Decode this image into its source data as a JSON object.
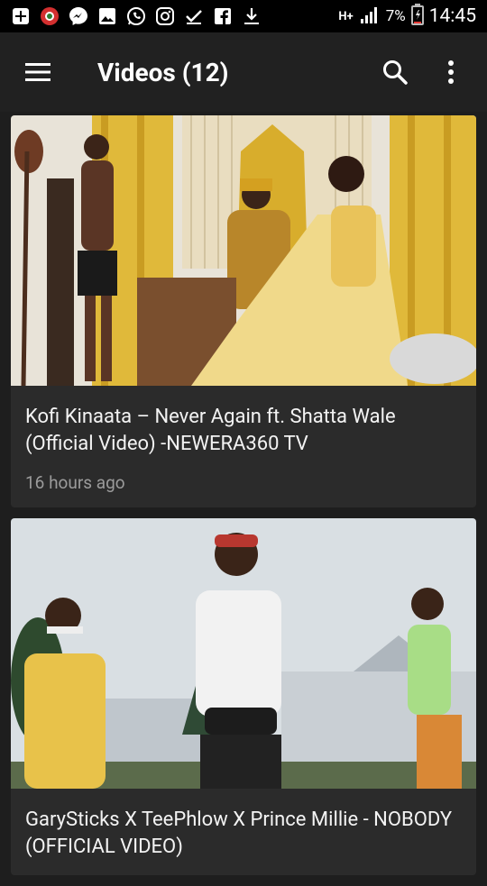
{
  "status_bar": {
    "left_icons": [
      "add-box-icon",
      "pinned-app-icon",
      "messenger-icon",
      "gallery-icon",
      "whatsapp-icon",
      "instagram-icon",
      "check-icon",
      "facebook-icon",
      "download-icon"
    ],
    "network": "H+",
    "battery": "7%",
    "time": "14:45"
  },
  "toolbar": {
    "title": "Videos (12)"
  },
  "videos": [
    {
      "title": "Kofi Kinaata – Never Again ft. Shatta Wale (Official Video) -NEWERA360 TV",
      "time": "16 hours ago"
    },
    {
      "title": "GarySticks X TeePhlow X Prince Millie - NOBODY (OFFICIAL VIDEO)"
    }
  ]
}
